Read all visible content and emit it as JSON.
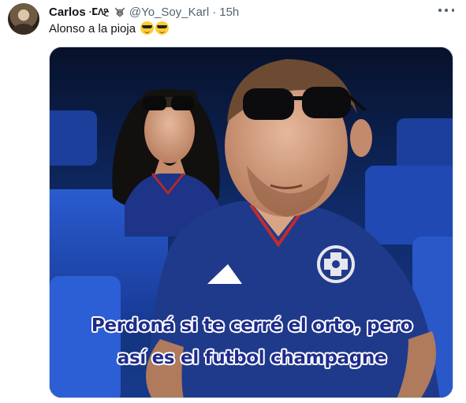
{
  "tweet": {
    "display_name": "Carlos",
    "name_decoration": "·ⵎΛⳈ",
    "badge_icon": "wolf-icon",
    "handle": "@Yo_Soy_Karl",
    "separator": "·",
    "time": "15h",
    "text": "Alonso a la pioja",
    "text_emojis": [
      "sunglasses-emoji",
      "sunglasses-emoji"
    ],
    "more_icon": "more-options-icon"
  },
  "media": {
    "caption_line1": "Perdoná si te cerré el orto, pero",
    "caption_line2": "así es el futbol champagne",
    "jersey_text": "CEMENTO\nCRUZ AZUL"
  },
  "colors": {
    "caption_fill": "#1e2c8c",
    "caption_stroke": "#ffffff",
    "secondary_text": "#536471",
    "jersey": "#1f3a8a"
  }
}
